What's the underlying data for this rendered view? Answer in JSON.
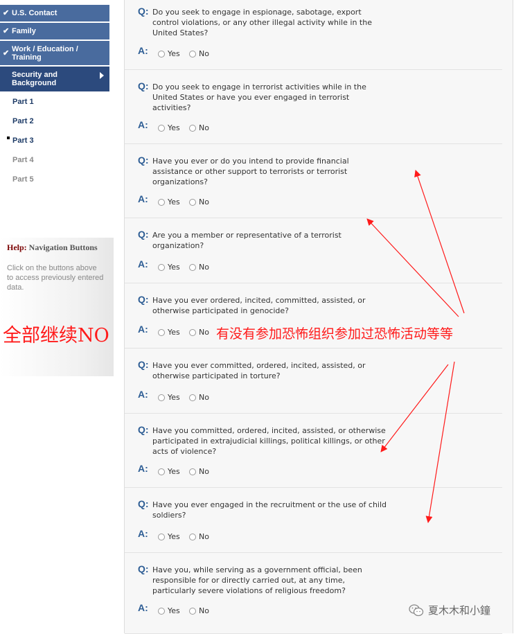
{
  "sidebar": {
    "completed": [
      "U.S. Contact",
      "Family",
      "Work / Education / Training"
    ],
    "current": "Security and Background",
    "parts": [
      "Part 1",
      "Part 2",
      "Part 3",
      "Part 4",
      "Part 5"
    ],
    "checkmark": "✔"
  },
  "help": {
    "title_prefix": "Help:",
    "title_rest": " Navigation Buttons",
    "text": "Click on the buttons above to access previously entered data."
  },
  "questions": [
    "Do you seek to engage in espionage, sabotage, export control violations, or any other illegal activity while in the United States?",
    "Do you seek to engage in terrorist activities while in the United States or have you ever engaged in terrorist activities?",
    "Have you ever or do you intend to provide financial assistance or other support to terrorists or terrorist organizations?",
    "Are you a member or representative of a terrorist organization?",
    "Have you ever ordered, incited, committed, assisted, or otherwise participated in genocide?",
    "Have you ever committed, ordered, incited, assisted, or otherwise participated in torture?",
    "Have you committed, ordered, incited, assisted, or otherwise participated in extrajudicial killings, political killings, or other acts of violence?",
    "Have you ever engaged in the recruitment or the use of child soldiers?",
    "Have you, while serving as a government official, been responsible for or directly carried out, at any time, particularly severe violations of religious freedom?"
  ],
  "labels": {
    "q": "Q:",
    "a": "A:",
    "yes": "Yes",
    "no": "No"
  },
  "annotations": {
    "left": "全部继续NO",
    "right": "有没有参加恐怖组织参加过恐怖活动等等"
  },
  "watermark": "夏木木和小鐘",
  "colors": {
    "nav_done": "#496b9e",
    "nav_current": "#2c4a7d",
    "q_label": "#2d5d94",
    "annotation": "#ff1a1a"
  }
}
